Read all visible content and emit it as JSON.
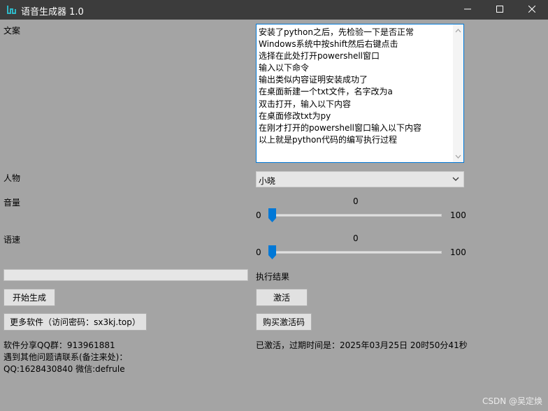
{
  "window": {
    "title": "语音生成器 1.0"
  },
  "labels": {
    "copy": "文案",
    "person": "人物",
    "volume": "音量",
    "speed": "语速",
    "result": "执行结果"
  },
  "textarea": {
    "lines": [
      "安装了python之后，先检验一下是否正常",
      "Windows系统中按shift然后右键点击",
      "选择在此处打开powershell窗口",
      "输入以下命令",
      "输出类似内容证明安装成功了",
      "在桌面新建一个txt文件，名字改为a",
      "双击打开，输入以下内容",
      "在桌面修改txt为py",
      "在刚才打开的powershell窗口输入以下内容",
      "以上就是python代码的编写执行过程"
    ]
  },
  "person_select": {
    "value": "小晓"
  },
  "volume": {
    "current": "0",
    "min": "0",
    "max": "100",
    "level": 0
  },
  "speed": {
    "current": "0",
    "min": "0",
    "max": "100",
    "level": 0
  },
  "progress": {
    "value": 0
  },
  "buttons": {
    "start": "开始生成",
    "activate": "激活",
    "more_software": "更多软件（访问密码：sx3kj.top）",
    "buy_code": "购买激活码"
  },
  "info": {
    "qq_group": "软件分享QQ群：913961881",
    "contact_line": "遇到其他问题请联系(备注来处)：",
    "contact_ids": "QQ:1628430840 微信:defrule",
    "activation_status": "已激活，过期时间是：2025年03月25日 20时50分41秒"
  },
  "watermark": "CSDN @吴定焕",
  "colors": {
    "accent": "#0078d7",
    "background": "#a4a4a4",
    "titlebar": "#3c3c3c"
  },
  "icons": {
    "app": "app-logo-icon",
    "minimize": "minimize-icon",
    "maximize": "maximize-icon",
    "close": "close-icon",
    "dropdown": "chevron-down-icon"
  }
}
